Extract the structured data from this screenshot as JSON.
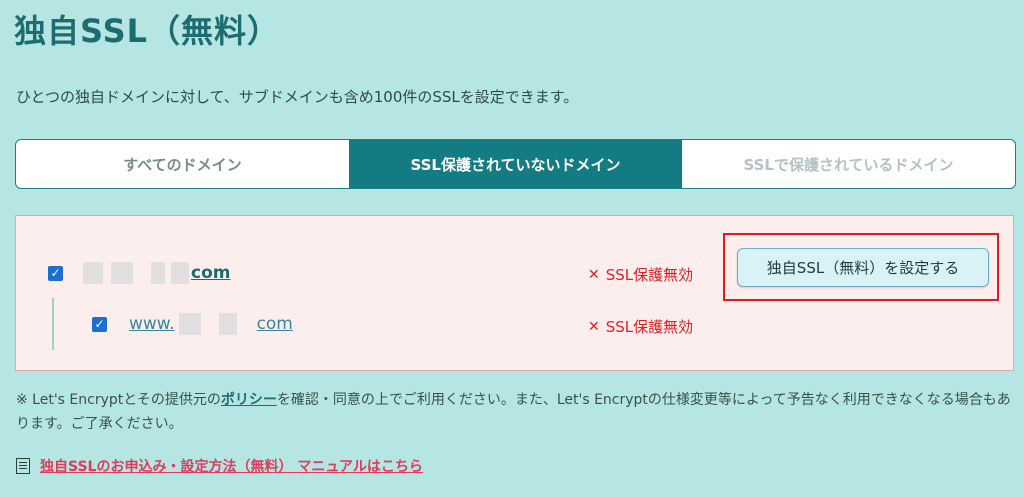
{
  "page": {
    "title": "独自SSL（無料）",
    "description": "ひとつの独自ドメインに対して、サブドメインも含め100件のSSLを設定できます。"
  },
  "tabs": [
    {
      "label": "すべてのドメイン"
    },
    {
      "label": "SSL保護されていないドメイン"
    },
    {
      "label": "SSLで保護されているドメイン"
    }
  ],
  "domains": {
    "main": {
      "checked": true,
      "suffix": "com",
      "status": "SSL保護無効"
    },
    "sub": {
      "checked": true,
      "prefix": "www.",
      "suffix": "com",
      "status": "SSL保護無効"
    }
  },
  "set_button": {
    "label": "独自SSL（無料）を設定する"
  },
  "note": {
    "before_link": "※ Let's Encryptとその提供元の",
    "link": "ポリシー",
    "after_link": "を確認・同意の上でご利用ください。また、Let's Encryptの仕様変更等によって予告なく利用できなくなる場合もあります。ご了承ください。"
  },
  "manual": {
    "link": "独自SSLのお申込み・設定方法（無料） マニュアルはこちら"
  },
  "colors": {
    "background": "#b5e6e3",
    "accent": "#137c82",
    "error": "#e02020",
    "highlight": "#e01b1b"
  }
}
